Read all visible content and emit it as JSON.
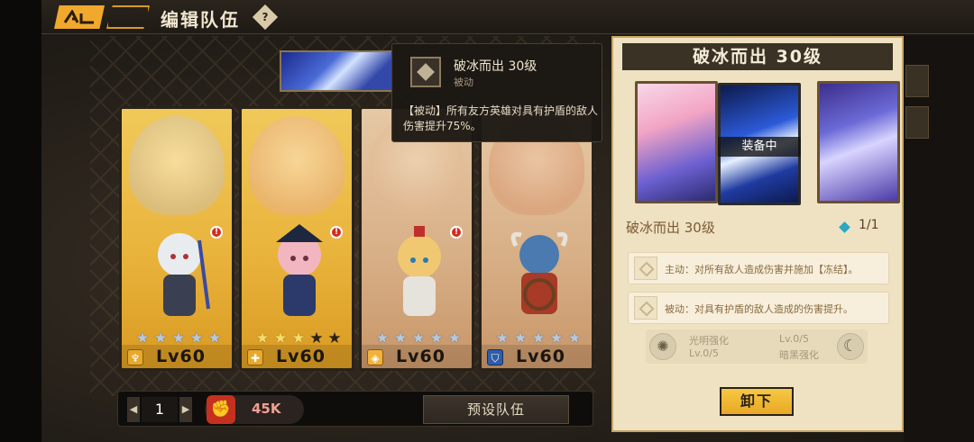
{
  "header": {
    "title": "编辑队伍",
    "help_icon_glyph": "?"
  },
  "heroes": [
    {
      "level": "Lv60",
      "stars_filled": 5,
      "stars_total": 5,
      "star_color": "silver",
      "class_icon": "staff-class-icon",
      "class_glyph": "♆",
      "alert": true,
      "card_style": "gold"
    },
    {
      "level": "Lv60",
      "stars_filled": 3,
      "stars_total": 5,
      "star_color": "gold",
      "class_icon": "cross-class-icon",
      "class_glyph": "✚",
      "alert": true,
      "card_style": "gold"
    },
    {
      "level": "Lv60",
      "stars_filled": 5,
      "stars_total": 5,
      "star_color": "silver",
      "class_icon": "shield-class-icon",
      "class_glyph": "◈",
      "alert": true,
      "card_style": "tan"
    },
    {
      "level": "Lv60",
      "stars_filled": 5,
      "stars_total": 5,
      "star_color": "silver",
      "class_icon": "guard-class-icon",
      "class_glyph": "⛉",
      "alert": false,
      "card_style": "tan"
    }
  ],
  "team": {
    "number": "1",
    "prev_glyph": "◀",
    "next_glyph": "▶",
    "power_value": "45K",
    "power_icon_glyph": "✊",
    "preset_label": "预设队伍"
  },
  "tooltip": {
    "name": "破冰而出 30级",
    "type": "被动",
    "description": "【被动】所有友方英雄对具有护盾的敌人伤害提升75%。"
  },
  "panel": {
    "title": "破冰而出 30级",
    "equipped_label": "装备中",
    "relic_name": "破冰而出 30级",
    "relic_count": "1/1",
    "active_skill": "主动：对所有敌人造成伤害并施加【冻结】。",
    "passive_skill": "被动：对具有护盾的敌人造成的伤害提升。",
    "light_name": "光明强化",
    "light_level": "Lv.0/5",
    "dark_level": "Lv.0/5",
    "dark_name": "暗黑强化",
    "unequip_label": "卸下"
  },
  "colors": {
    "accent_orange": "#f0a92c",
    "panel_bg": "#efe2c2",
    "power_red": "#c5301f",
    "count_cyan": "#2aa8c4"
  }
}
